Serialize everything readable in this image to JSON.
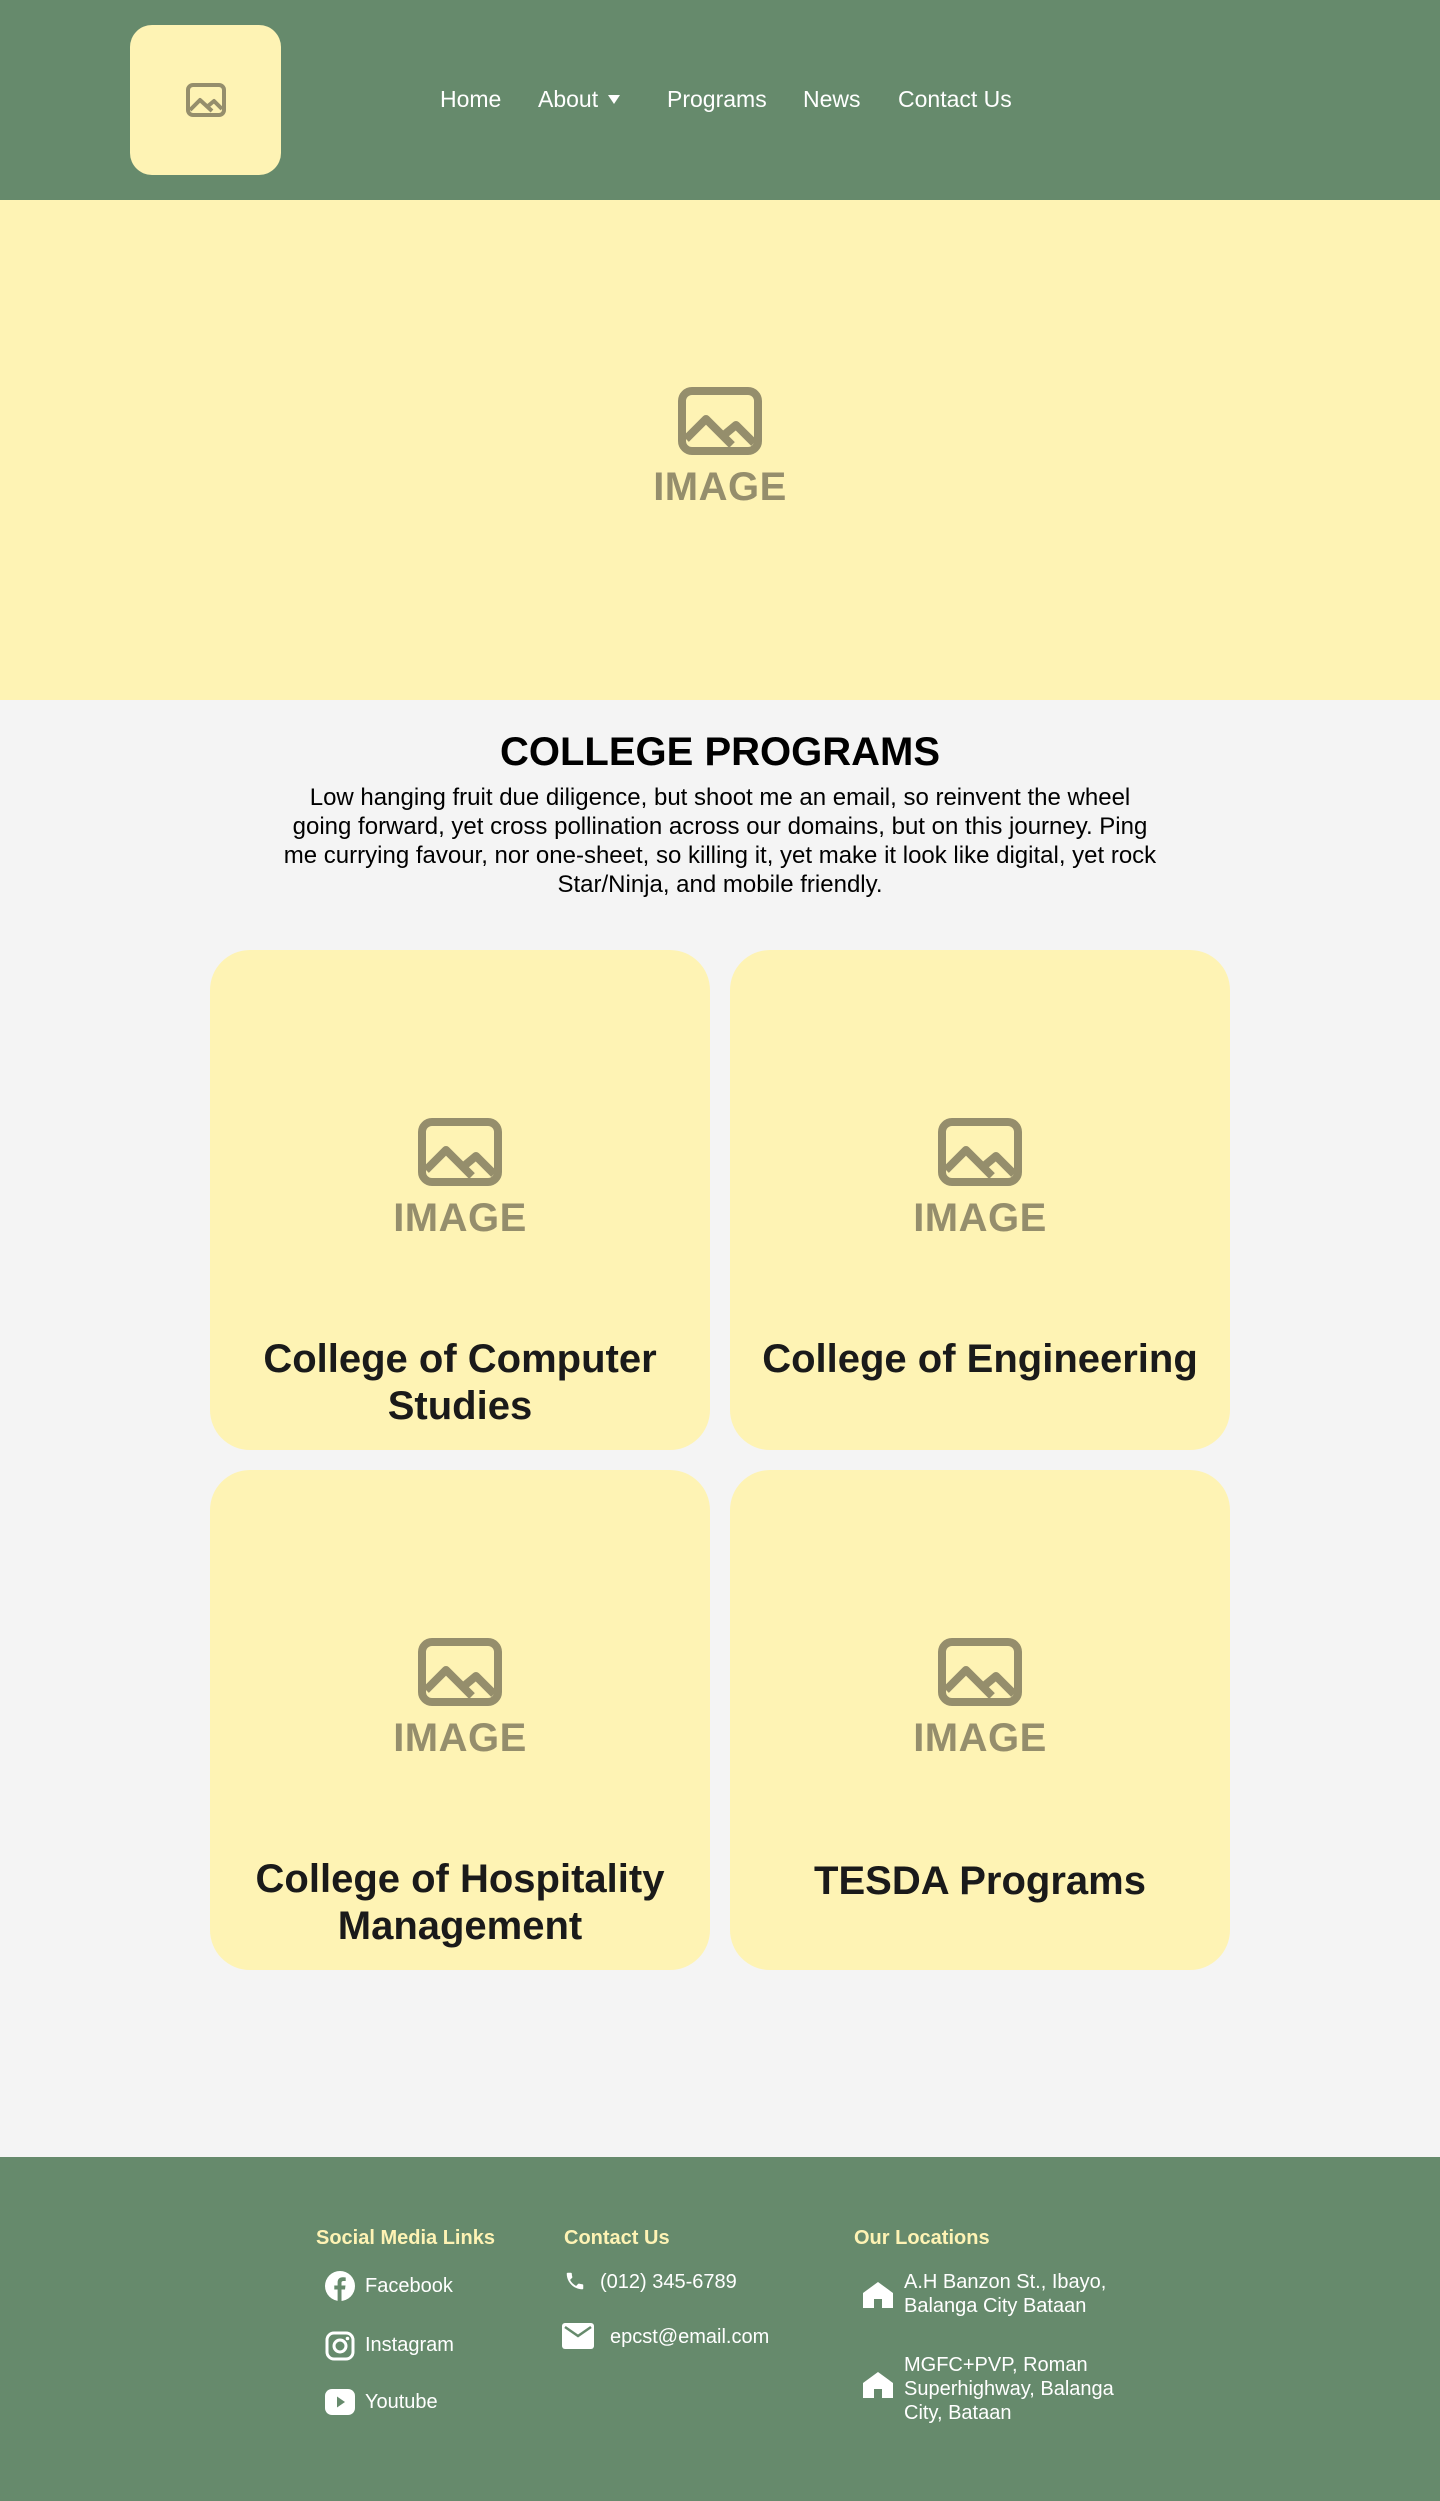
{
  "header": {
    "logo_icon": "image-icon",
    "nav": {
      "home": "Home",
      "about": "About",
      "programs": "Programs",
      "news": "News",
      "contact": "Contact Us"
    }
  },
  "hero": {
    "placeholder_label": "IMAGE",
    "icon": "image-icon"
  },
  "programs": {
    "title": "COLLEGE PROGRAMS",
    "description": "Low hanging fruit due diligence, but shoot me an email, so reinvent the wheel going forward, yet cross pollination across our domains, but on this journey. Ping me currying favour, nor one-sheet, so killing it, yet make it look like digital, yet rock Star/Ninja, and mobile friendly.",
    "cards": [
      {
        "placeholder_label": "IMAGE",
        "title": "College of Computer Studies"
      },
      {
        "placeholder_label": "IMAGE",
        "title": "College of Engineering"
      },
      {
        "placeholder_label": "IMAGE",
        "title": "College of Hospitality Management"
      },
      {
        "placeholder_label": "IMAGE",
        "title": "TESDA Programs"
      }
    ]
  },
  "footer": {
    "social": {
      "heading": "Social Media Links",
      "items": [
        {
          "label": "Facebook",
          "icon": "facebook-icon"
        },
        {
          "label": "Instagram",
          "icon": "instagram-icon"
        },
        {
          "label": "Youtube",
          "icon": "youtube-icon"
        }
      ]
    },
    "contact": {
      "heading": "Contact Us",
      "phone": "(012) 345-6789",
      "email": "epcst@email.com"
    },
    "locations": {
      "heading": "Our Locations",
      "items": [
        "A.H Banzon St., Ibayo, Balanga City Bataan",
        "MGFC+PVP, Roman Superhighway, Balanga City, Bataan"
      ]
    }
  },
  "colors": {
    "header_bg": "#668a6c",
    "cream": "#fef3b4",
    "placeholder": "#958e6c",
    "page_bg": "#f4f4f4"
  }
}
